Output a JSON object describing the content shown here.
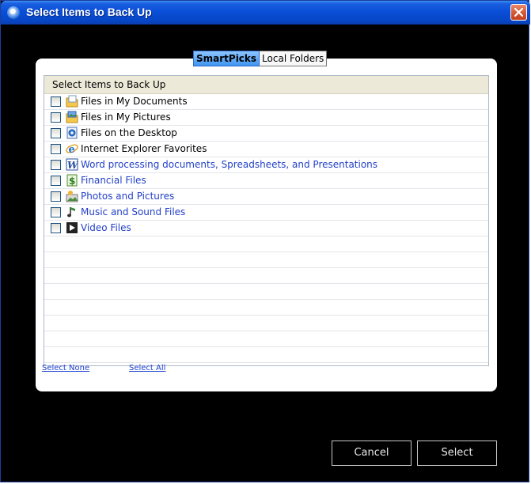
{
  "window": {
    "title": "Select Items to Back Up"
  },
  "tabs": [
    {
      "label": "SmartPicks",
      "active": true
    },
    {
      "label": "Local Folders",
      "active": false
    }
  ],
  "list": {
    "header": "Select Items to Back Up",
    "items": [
      {
        "label": "Files in My Documents",
        "icon": "my-documents-icon",
        "checked": false,
        "color": "#000000"
      },
      {
        "label": "Files in My Pictures",
        "icon": "my-pictures-icon",
        "checked": false,
        "color": "#000000"
      },
      {
        "label": "Files on the Desktop",
        "icon": "desktop-icon",
        "checked": false,
        "color": "#000000"
      },
      {
        "label": "Internet Explorer Favorites",
        "icon": "internet-explorer-icon",
        "checked": false,
        "color": "#000000"
      },
      {
        "label": "Word processing documents, Spreadsheets, and Presentations",
        "icon": "word-document-icon",
        "checked": false,
        "color": "#2341c8"
      },
      {
        "label": "Financial Files",
        "icon": "dollar-icon",
        "checked": false,
        "color": "#2341c8"
      },
      {
        "label": "Photos and Pictures",
        "icon": "photos-icon",
        "checked": false,
        "color": "#2341c8"
      },
      {
        "label": "Music and Sound Files",
        "icon": "music-icon",
        "checked": false,
        "color": "#2341c8"
      },
      {
        "label": "Video Files",
        "icon": "video-icon",
        "checked": false,
        "color": "#2341c8"
      }
    ]
  },
  "links": {
    "select_none": "Select None",
    "select_all": "Select All"
  },
  "buttons": {
    "cancel": "Cancel",
    "select": "Select"
  },
  "colors": {
    "title_bar": "#0a4fd8",
    "link": "#1a3fd0",
    "background": "#000000"
  }
}
